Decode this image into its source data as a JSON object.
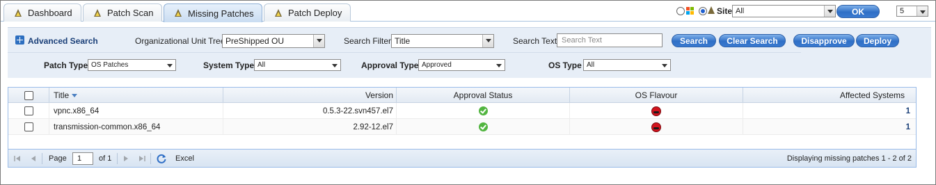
{
  "tabs": [
    {
      "label": "Dashboard"
    },
    {
      "label": "Patch Scan"
    },
    {
      "label": "Missing Patches"
    },
    {
      "label": "Patch Deploy"
    }
  ],
  "topbar": {
    "site_label": "Site",
    "site_value": "All",
    "ok_label": "OK",
    "count_value": "5"
  },
  "filters": {
    "advanced_search": "Advanced Search",
    "ou_label": "Organizational Unit Tree",
    "ou_value": "PreShipped OU",
    "search_filter_label": "Search Filter",
    "search_filter_value": "Title",
    "search_text_label": "Search Text",
    "search_text_placeholder": "Search Text",
    "search_btn": "Search",
    "clear_btn": "Clear Search",
    "disapprove_btn": "Disapprove",
    "deploy_btn": "Deploy",
    "patch_type_label": "Patch Type",
    "patch_type_value": "OS Patches",
    "system_type_label": "System Type",
    "system_type_value": "All",
    "approval_type_label": "Approval Type",
    "approval_type_value": "Approved",
    "os_type_label": "OS Type",
    "os_type_value": "All"
  },
  "grid": {
    "columns": [
      "Title",
      "Version",
      "Approval Status",
      "OS Flavour",
      "Affected Systems"
    ],
    "rows": [
      {
        "title": "vpnc.x86_64",
        "version": "0.5.3-22.svn457.el7",
        "approval_icon": "approved-check-icon",
        "os_icon": "redhat-icon",
        "affected": "1"
      },
      {
        "title": "transmission-common.x86_64",
        "version": "2.92-12.el7",
        "approval_icon": "approved-check-icon",
        "os_icon": "redhat-icon",
        "affected": "1"
      }
    ]
  },
  "pager": {
    "page_label": "Page",
    "page_value": "1",
    "of_label": "of 1",
    "excel_label": "Excel",
    "display_text": "Displaying missing patches 1 - 2 of 2"
  },
  "colors": {
    "accent": "#2f6fc6",
    "panel": "#e7eef7",
    "ok": "#52b540",
    "redhat": "#d2141e"
  }
}
